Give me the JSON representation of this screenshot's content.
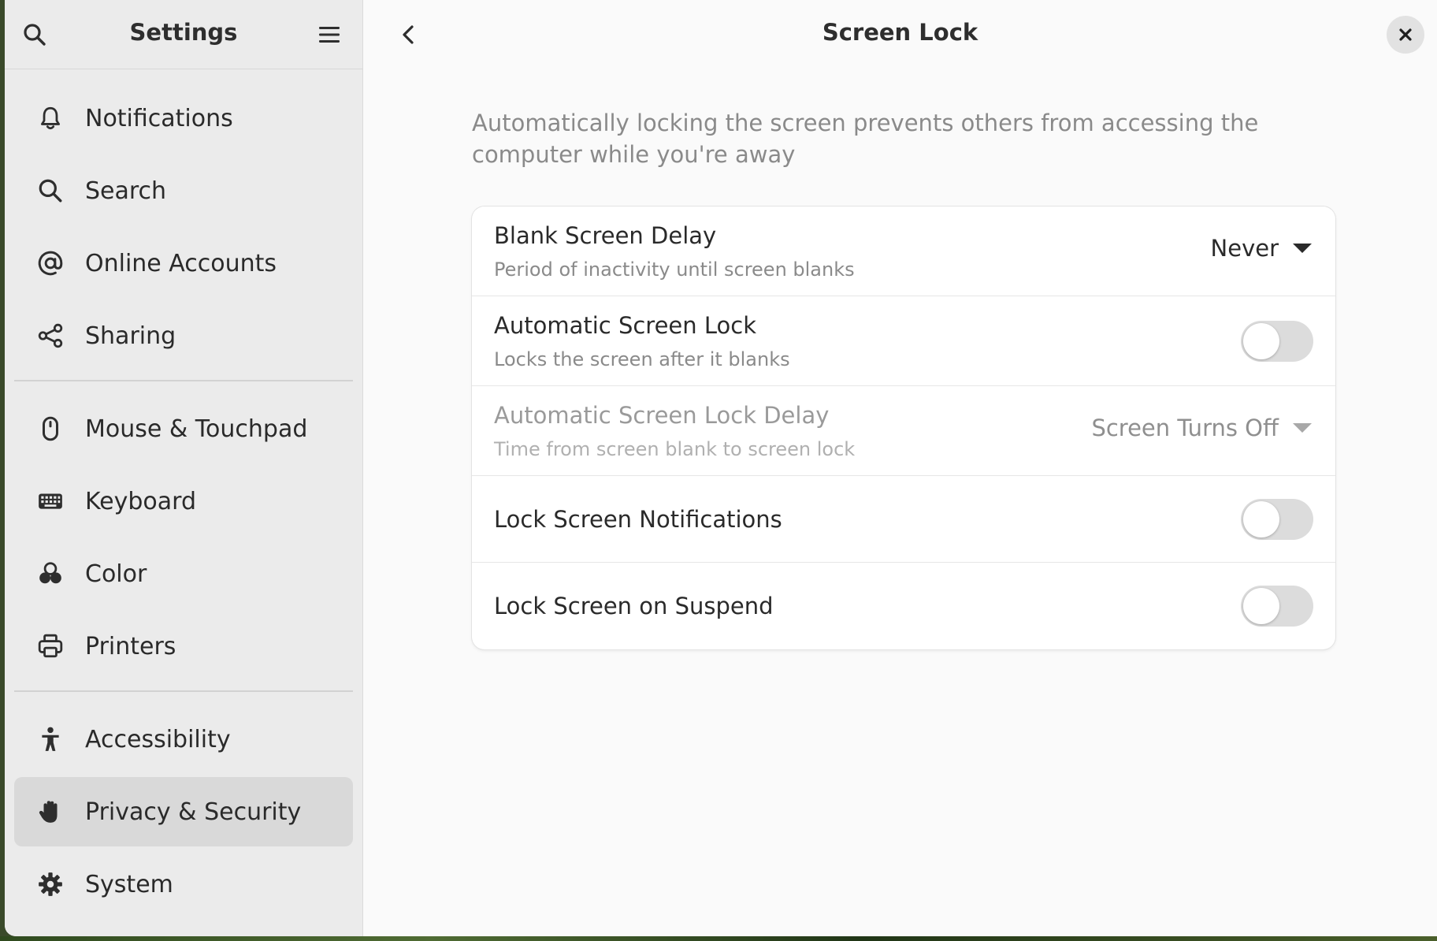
{
  "sidebar": {
    "title": "Settings",
    "groups": [
      {
        "items": [
          {
            "label": "Notifications",
            "icon": "bell-icon"
          },
          {
            "label": "Search",
            "icon": "search-icon"
          },
          {
            "label": "Online Accounts",
            "icon": "at-sign-icon"
          },
          {
            "label": "Sharing",
            "icon": "share-icon"
          }
        ]
      },
      {
        "items": [
          {
            "label": "Mouse & Touchpad",
            "icon": "mouse-icon"
          },
          {
            "label": "Keyboard",
            "icon": "keyboard-icon"
          },
          {
            "label": "Color",
            "icon": "color-icon"
          },
          {
            "label": "Printers",
            "icon": "printer-icon"
          }
        ]
      },
      {
        "items": [
          {
            "label": "Accessibility",
            "icon": "accessibility-icon"
          },
          {
            "label": "Privacy & Security",
            "icon": "hand-icon",
            "active": true
          },
          {
            "label": "System",
            "icon": "gear-icon"
          }
        ]
      }
    ]
  },
  "main": {
    "title": "Screen Lock",
    "description": "Automatically locking the screen prevents others from accessing the computer while you're away",
    "rows": [
      {
        "title": "Blank Screen Delay",
        "subtitle": "Period of inactivity until screen blanks",
        "control": "dropdown",
        "value": "Never"
      },
      {
        "title": "Automatic Screen Lock",
        "subtitle": "Locks the screen after it blanks",
        "control": "toggle",
        "on": false
      },
      {
        "title": "Automatic Screen Lock Delay",
        "subtitle": "Time from screen blank to screen lock",
        "control": "dropdown",
        "value": "Screen Turns Off",
        "disabled": true
      },
      {
        "title": "Lock Screen Notifications",
        "control": "toggle",
        "on": false
      },
      {
        "title": "Lock Screen on Suspend",
        "control": "toggle",
        "on": false
      }
    ]
  },
  "colors": {
    "sidebar_bg": "#ebebeb",
    "active_item_bg": "#d9d9d9",
    "content_bg": "#fafafa",
    "toggle_off": "#dcdcdc"
  }
}
